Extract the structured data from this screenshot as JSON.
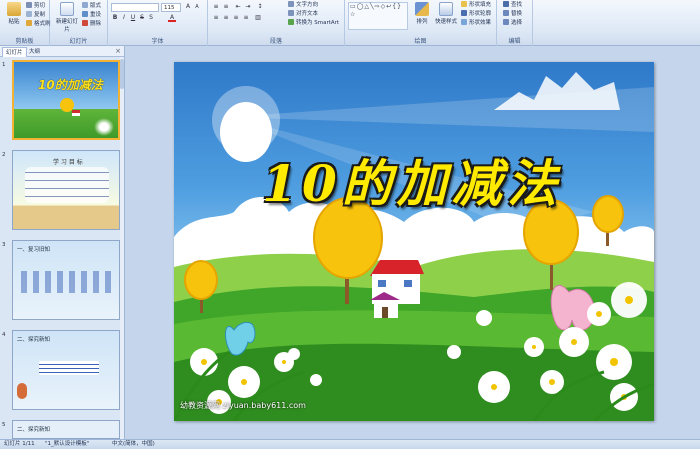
{
  "ribbon": {
    "clipboard": {
      "label": "剪贴板",
      "paste": "粘贴",
      "cut": "剪切",
      "copy": "复制",
      "format_painter": "格式刷"
    },
    "slides": {
      "label": "幻灯片",
      "new_slide": "新建幻灯片",
      "layout": "版式",
      "reset": "重设",
      "delete": "删除"
    },
    "font": {
      "label": "字体",
      "font_size": "115"
    },
    "paragraph": {
      "label": "段落",
      "text_direction": "文字方向",
      "align_text": "对齐文本",
      "smartart": "转换为 SmartArt"
    },
    "drawing": {
      "label": "绘图",
      "arrange": "排列",
      "quick_styles": "快速样式",
      "shape_fill": "形状填充",
      "shape_outline": "形状轮廓",
      "shape_effects": "形状效果"
    },
    "editing": {
      "label": "编辑",
      "find": "查找",
      "replace": "替换",
      "select": "选择"
    }
  },
  "left_panel": {
    "tab_slides": "幻灯片",
    "tab_outline": "大纲",
    "close": "×",
    "slides": [
      {
        "num": "1",
        "title": "10的加减法"
      },
      {
        "num": "2",
        "title": "学 习 目 标"
      },
      {
        "num": "3",
        "title": "一、复习旧知"
      },
      {
        "num": "4",
        "title": "二、探究新知"
      },
      {
        "num": "5",
        "title": "二、探究新知"
      }
    ]
  },
  "slide": {
    "title": "10的加减法",
    "watermark": "幼教资源网 ziyuan.baby611.com"
  },
  "status": {
    "slide_counter": "幻灯片 1/11",
    "theme": "\"1_默认设计模板\"",
    "language": "中文(简体，中国)"
  }
}
